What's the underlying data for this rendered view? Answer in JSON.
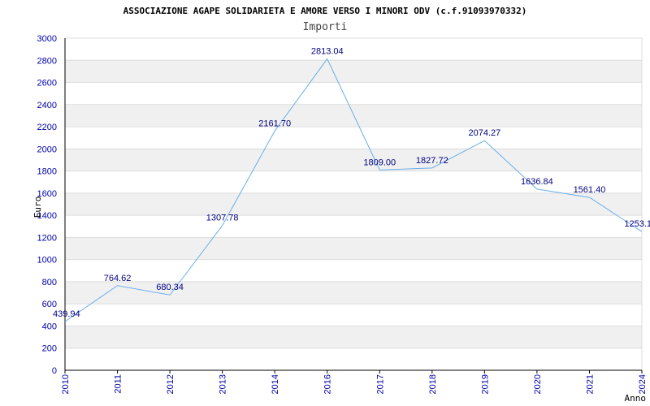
{
  "chart_data": {
    "type": "line",
    "title": "ASSOCIAZIONE AGAPE SOLIDARIETA E AMORE VERSO I MINORI ODV (c.f.91093970332)",
    "subtitle": "Importi",
    "ylabel": "Euro",
    "xlabel": "Anno",
    "ylim": [
      0,
      3000
    ],
    "yticks": [
      0,
      200,
      400,
      600,
      800,
      1000,
      1200,
      1400,
      1600,
      1800,
      2000,
      2200,
      2400,
      2600,
      2800,
      3000
    ],
    "categories": [
      "2010",
      "2011",
      "2012",
      "2013",
      "2014",
      "2016",
      "2017",
      "2018",
      "2019",
      "2020",
      "2021",
      "2024"
    ],
    "values": [
      439.94,
      764.62,
      680.34,
      1307.78,
      2161.7,
      2813.04,
      1809.0,
      1827.72,
      2074.27,
      1636.84,
      1561.4,
      1253.1
    ],
    "data_labels": [
      "439.94",
      "764.62",
      "680.34",
      "1307.78",
      "2161.70",
      "2813.04",
      "1809.00",
      "1827.72",
      "2074.27",
      "1636.84",
      "1561.40",
      "1253.1"
    ],
    "grid": true,
    "colors": {
      "line": "#6aaee8",
      "band": "#f0f0f0",
      "grid": "#dddddd",
      "axis_text": "#0000aa",
      "title_text": "#000000",
      "label_text": "#000080"
    }
  }
}
